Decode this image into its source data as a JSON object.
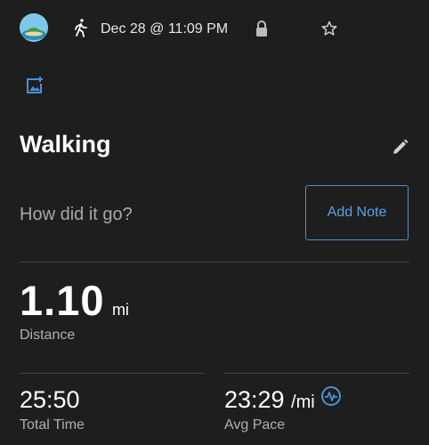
{
  "header": {
    "date_time": "Dec 28 @ 11:09 PM"
  },
  "activity": {
    "title": "Walking",
    "note_prompt": "How did it go?",
    "add_note_label": "Add Note"
  },
  "stats": {
    "distance": {
      "value": "1.10",
      "unit": "mi",
      "label": "Distance"
    },
    "total_time": {
      "value": "25:50",
      "label": "Total Time"
    },
    "avg_pace": {
      "value": "23:29",
      "unit": "/mi",
      "label": "Avg Pace"
    }
  },
  "colors": {
    "background": "#1e1e1e",
    "accent": "#4a90d9",
    "divider": "#444444"
  },
  "icons": [
    "avatar",
    "walking-icon",
    "lock-icon",
    "star-icon",
    "add-photo-icon",
    "edit-pencil-icon",
    "heart-rate-badge-icon"
  ]
}
